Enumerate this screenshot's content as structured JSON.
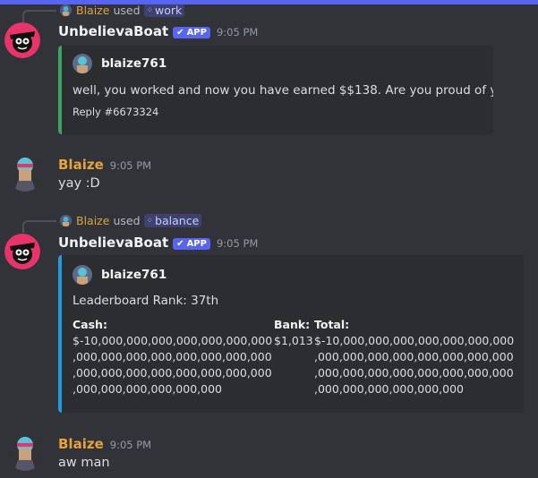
{
  "colors": {
    "accent": "#5865f2",
    "embed_bar_work": "#3ba55d",
    "embed_bar_balance": "#1e9de0",
    "user_name": "#e7a33b",
    "background": "#313338"
  },
  "messages": [
    {
      "reply": {
        "user": "Blaize",
        "used": "used",
        "command": "work",
        "command_icon": "slash-command-icon"
      },
      "author": "UnbelievaBoat",
      "badge": "APP",
      "time": "9:05 PM",
      "embed": {
        "author": "blaize761",
        "description": "well, you worked and now you have earned $$138. Are you proud of yourself?",
        "footer": "Reply #6673324"
      }
    },
    {
      "author": "Blaize",
      "time": "9:05 PM",
      "text": "yay :D"
    },
    {
      "reply": {
        "user": "Blaize",
        "used": "used",
        "command": "balance",
        "command_icon": "slash-command-icon"
      },
      "author": "UnbelievaBoat",
      "badge": "APP",
      "time": "9:05 PM",
      "embed": {
        "author": "blaize761",
        "description": "Leaderboard Rank: 37th",
        "fields": [
          {
            "name": "Cash:",
            "lines": [
              "$-10,000,000,000,000,000,000,000",
              ",000,000,000,000,000,000,000,000",
              ",000,000,000,000,000,000,000,000",
              ",000,000,000,000,000,000"
            ]
          },
          {
            "name": "Bank:",
            "lines": [
              "$1,013"
            ]
          },
          {
            "name": "Total:",
            "lines": [
              "$-10,000,000,000,000,000,000,000",
              ",000,000,000,000,000,000,000,000",
              ",000,000,000,000,000,000,000,000",
              ",000,000,000,000,000,000"
            ]
          }
        ]
      }
    },
    {
      "author": "Blaize",
      "time": "9:05 PM",
      "text": "aw man"
    }
  ]
}
